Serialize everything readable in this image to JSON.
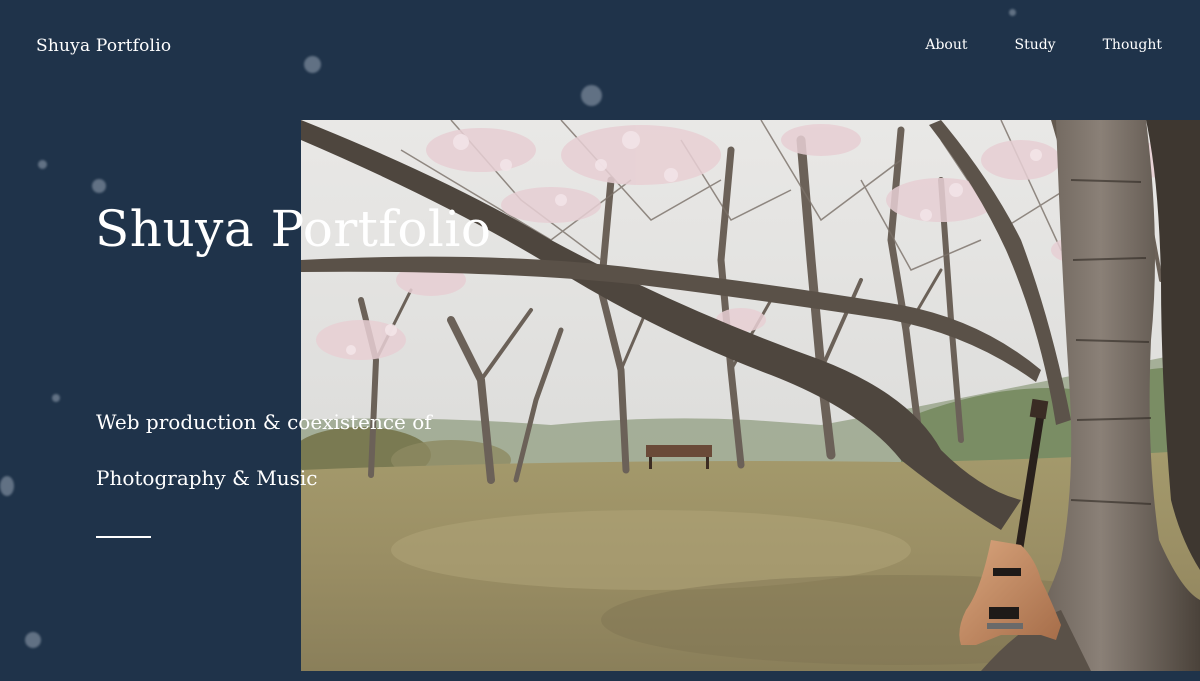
{
  "header": {
    "logo": "Shuya Portfolio",
    "nav": [
      {
        "label": "About"
      },
      {
        "label": "Study"
      },
      {
        "label": "Thought"
      }
    ]
  },
  "hero": {
    "title": "Shuya Portfolio",
    "tagline_line1": "Web production & coexistence of",
    "tagline_line2": "Photography & Music"
  },
  "colors": {
    "background": "#1f334a",
    "text": "#ffffff"
  }
}
